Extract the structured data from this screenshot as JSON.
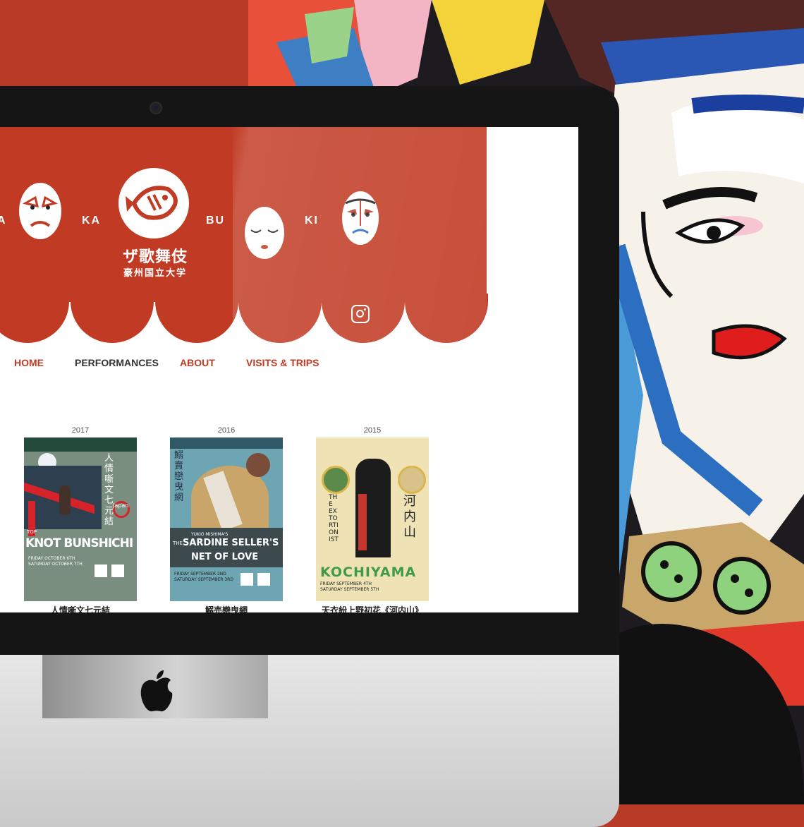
{
  "syllables": [
    "A",
    "KA",
    "BU",
    "KI"
  ],
  "logo": {
    "title": "ザ歌舞伎",
    "subtitle": "豪州国立大学"
  },
  "nav": {
    "items": [
      "HOME",
      "PERFORMANCES",
      "ABOUT",
      "VISITS & TRIPS"
    ],
    "active": "PERFORMANCES"
  },
  "performances": [
    {
      "year": "2017",
      "title": "人情噺文七元結",
      "poster_main": "KNOT BUNSHICHI",
      "poster_prefix": "TOP",
      "poster_vertical": "人情噺文七元結",
      "poster_tag": "Japan",
      "poster_date1": "FRIDAY OCTOBER 6TH",
      "poster_date2": "SATURDAY OCTOBER 7TH"
    },
    {
      "year": "2016",
      "title": "鰯売戀曳網",
      "poster_main": "SARDINE SELLER'S",
      "poster_main2": "NET OF LOVE",
      "poster_prefix": "THE",
      "poster_credit": "YUKIO MISHIMA'S",
      "poster_vertical": "鰯賣戀曳網",
      "poster_date1": "FRIDAY SEPTEMBER 2ND",
      "poster_date2": "SATURDAY SEPTEMBER 3RD"
    },
    {
      "year": "2015",
      "title": "天衣紛上野初花《河内山》",
      "poster_main": "KOCHIYAMA",
      "poster_vertical_en": "THE EXTORTIONIST",
      "poster_vertical": "河内山",
      "poster_date1": "FRIDAY SEPTEMBER 4TH",
      "poster_date2": "SATURDAY SEPTEMBER 5TH"
    }
  ],
  "colors": {
    "brand_red": "#c13b24",
    "bezel": "#151515",
    "nav_active": "#333333"
  }
}
